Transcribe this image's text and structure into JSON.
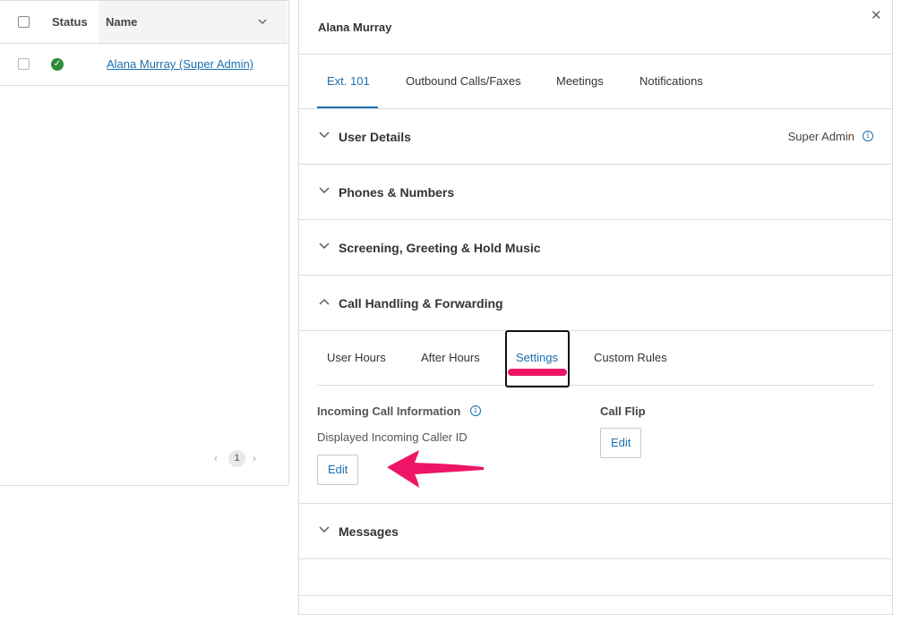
{
  "user_list": {
    "columns": {
      "status": "Status",
      "name": "Name"
    },
    "rows": [
      {
        "status": "active",
        "name": "Alana Murray (Super Admin)"
      }
    ],
    "pagination": {
      "current_page": "1",
      "prev_glyph": "‹",
      "next_glyph": "›"
    }
  },
  "detail": {
    "user_name": "Alana Murray",
    "close_glyph": "✕",
    "tabs": [
      {
        "label": "Ext. 101",
        "active": true
      },
      {
        "label": "Outbound Calls/Faxes",
        "active": false
      },
      {
        "label": "Meetings",
        "active": false
      },
      {
        "label": "Notifications",
        "active": false
      }
    ],
    "sections": {
      "user_details": {
        "title": "User Details",
        "role": "Super Admin",
        "expanded": false
      },
      "phones_numbers": {
        "title": "Phones & Numbers",
        "expanded": false
      },
      "screening": {
        "title": "Screening, Greeting & Hold Music",
        "expanded": false
      },
      "call_handling": {
        "title": "Call Handling & Forwarding",
        "expanded": true
      },
      "messages": {
        "title": "Messages",
        "expanded": false
      }
    },
    "call_handling_tabs": [
      {
        "label": "User Hours",
        "active": false
      },
      {
        "label": "After Hours",
        "active": false
      },
      {
        "label": "Settings",
        "active": true
      },
      {
        "label": "Custom Rules",
        "active": false
      }
    ],
    "incoming_call_info": {
      "title": "Incoming Call Information",
      "sub_label": "Displayed Incoming Caller ID",
      "edit_label": "Edit"
    },
    "call_flip": {
      "title": "Call Flip",
      "edit_label": "Edit"
    }
  },
  "annotations": {
    "highlight_color": "#ee1566",
    "accent_color": "#1a6fb0"
  },
  "icons": {
    "status": "check-circle-icon",
    "sort": "chevron-down-icon",
    "collapsed": "chevron-down-icon",
    "expanded": "chevron-up-icon",
    "info": "info-icon",
    "close": "close-icon"
  }
}
